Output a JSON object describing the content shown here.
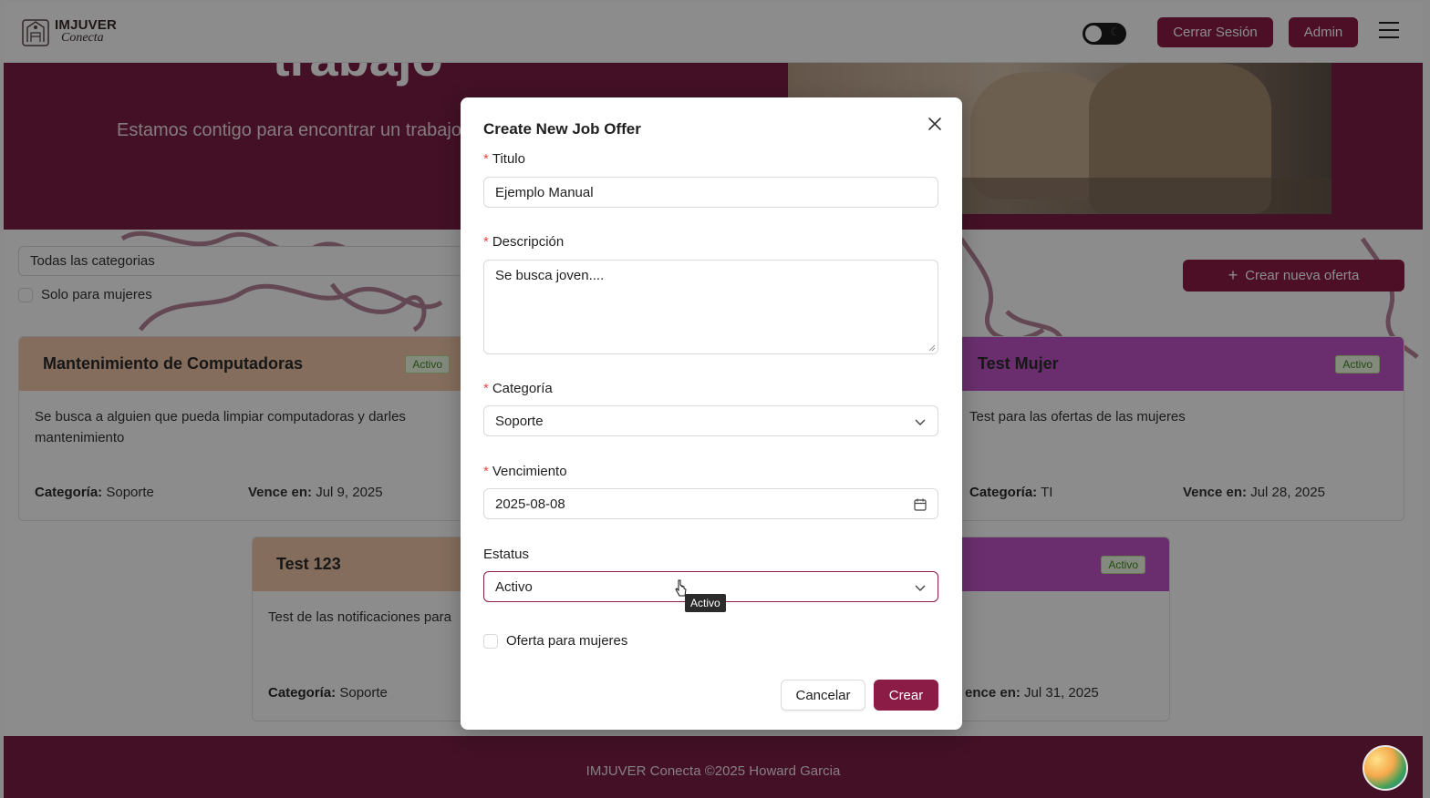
{
  "header": {
    "logo_title": "IMJUVER",
    "logo_subtitle": "Conecta",
    "logout_label": "Cerrar Sesión",
    "admin_label": "Admin"
  },
  "hero": {
    "title": "trabajo",
    "subtitle": "Estamos contigo para encontrar un trabajo"
  },
  "filters": {
    "category_select_value": "Todas las categorias",
    "women_only_label": "Solo para mujeres",
    "create_offer_label": "Crear nueva oferta"
  },
  "cards": [
    {
      "title": "Mantenimiento de Computadoras",
      "status": "Activo",
      "description": "Se busca a alguien que pueda limpiar computadoras y darles mantenimiento",
      "category_label": "Categoría:",
      "category": "Soporte",
      "expires_label": "Vence en:",
      "expires": "Jul 9, 2025"
    },
    {
      "title": "Test Mujer",
      "status": "Activo",
      "description": "Test para las ofertas de las mujeres",
      "category_label": "Categoría:",
      "category": "TI",
      "expires_label": "Vence en:",
      "expires": "Jul 28, 2025"
    },
    {
      "title": "Test 123",
      "description": "Test de las notificaciones para",
      "category_label": "Categoría:",
      "category": "Soporte"
    },
    {
      "status": "Activo",
      "expires_label": "ence en:",
      "expires": "Jul 31, 2025"
    }
  ],
  "footer": {
    "text": "IMJUVER Conecta ©2025 Howard Garcia"
  },
  "modal": {
    "title": "Create New Job Offer",
    "titulo_label": "Titulo",
    "titulo_value": "Ejemplo Manual",
    "descripcion_label": "Descripción",
    "descripcion_value": "Se busca joven....",
    "categoria_label": "Categoría",
    "categoria_value": "Soporte",
    "vencimiento_label": "Vencimiento",
    "vencimiento_value": "2025-08-08",
    "estatus_label": "Estatus",
    "estatus_value": "Activo",
    "tooltip": "Activo",
    "women_offer_label": "Oferta para mujeres",
    "cancel_label": "Cancelar",
    "create_label": "Crear"
  },
  "colors": {
    "brand": "#8b1c46",
    "hero_bg": "#7a1e45",
    "card_peach": "#f0c7a8",
    "card_purple": "#c255c8",
    "badge_green": "#3f8a1f",
    "required": "#e54848"
  },
  "icons": [
    "logo-mark-icon",
    "theme-toggle-icon",
    "menu-icon",
    "plus-icon",
    "close-icon",
    "chevron-down-icon",
    "calendar-icon",
    "resize-grip-icon",
    "cursor-icon",
    "avatar-icon"
  ]
}
